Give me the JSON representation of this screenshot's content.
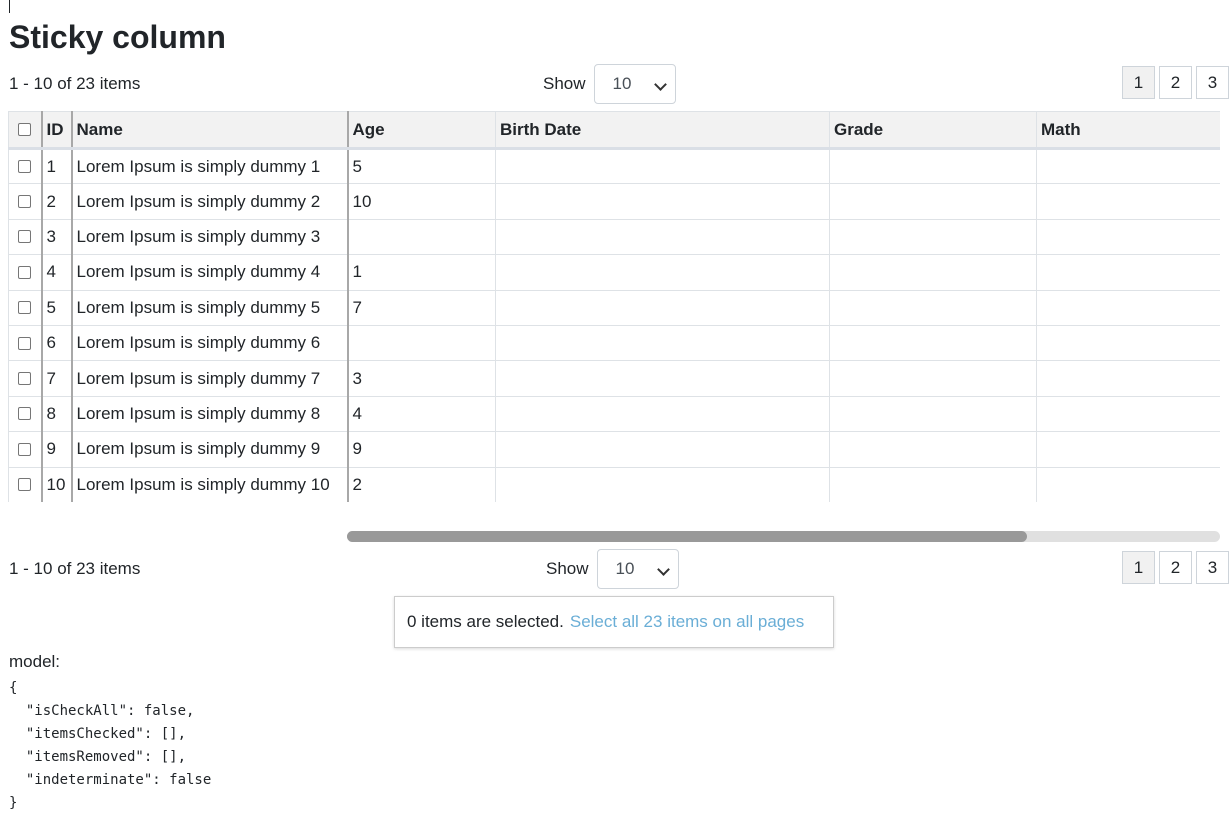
{
  "page": {
    "title": "Sticky column"
  },
  "top_bar": {
    "summary": "1 - 10 of 23 items",
    "show_label": "Show",
    "page_size": "10",
    "pages": [
      "1",
      "2",
      "3"
    ],
    "active_page": "1"
  },
  "bottom_bar": {
    "summary": "1 - 10 of 23 items",
    "show_label": "Show",
    "page_size": "10",
    "pages": [
      "1",
      "2",
      "3"
    ],
    "active_page": "1"
  },
  "table": {
    "columns": [
      "",
      "ID",
      "Name",
      "Age",
      "Birth Date",
      "Grade",
      "Math"
    ],
    "rows": [
      {
        "id": "1",
        "name": "Lorem Ipsum is simply dummy 1",
        "age": "5"
      },
      {
        "id": "2",
        "name": "Lorem Ipsum is simply dummy 2",
        "age": "10"
      },
      {
        "id": "3",
        "name": "Lorem Ipsum is simply dummy 3",
        "age": ""
      },
      {
        "id": "4",
        "name": "Lorem Ipsum is simply dummy 4",
        "age": "1"
      },
      {
        "id": "5",
        "name": "Lorem Ipsum is simply dummy 5",
        "age": "7"
      },
      {
        "id": "6",
        "name": "Lorem Ipsum is simply dummy 6",
        "age": ""
      },
      {
        "id": "7",
        "name": "Lorem Ipsum is simply dummy 7",
        "age": "3"
      },
      {
        "id": "8",
        "name": "Lorem Ipsum is simply dummy 8",
        "age": "4"
      },
      {
        "id": "9",
        "name": "Lorem Ipsum is simply dummy 9",
        "age": "9"
      },
      {
        "id": "10",
        "name": "Lorem Ipsum is simply dummy 10",
        "age": "2"
      }
    ]
  },
  "horizontal_scroll": {
    "position": 0.78
  },
  "selection": {
    "text": "0 items are selected.",
    "link": "Select all 23 items on all pages"
  },
  "model": {
    "label": "model:",
    "json_text": "{\n  \"isCheckAll\": false,\n  \"itemsChecked\": [],\n  \"itemsRemoved\": [],\n  \"indeterminate\": false\n}"
  },
  "colors": {
    "link": "#6aaed6",
    "header_bg": "#f2f2f2",
    "scroll_thumb": "#999999"
  }
}
